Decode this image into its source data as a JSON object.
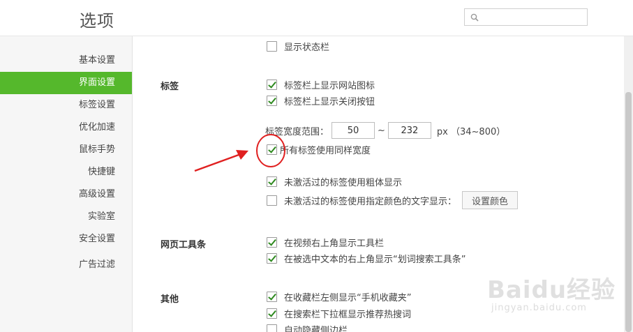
{
  "header": {
    "title": "选项",
    "search": {
      "placeholder": "",
      "value": ""
    }
  },
  "sidebar": {
    "items": [
      {
        "label": "基本设置",
        "active": false
      },
      {
        "label": "界面设置",
        "active": true
      },
      {
        "label": "标签设置",
        "active": false
      },
      {
        "label": "优化加速",
        "active": false
      },
      {
        "label": "鼠标手势",
        "active": false
      },
      {
        "label": "快捷键",
        "active": false
      },
      {
        "label": "高级设置",
        "active": false
      },
      {
        "label": "实验室",
        "active": false
      },
      {
        "label": "安全设置",
        "active": false
      },
      {
        "label": "广告过滤",
        "active": false
      }
    ]
  },
  "content": {
    "top_option": {
      "label": "显示状态栏",
      "checked": false
    },
    "tabs_section": {
      "title": "标签",
      "options": [
        {
          "label": "标签栏上显示网站图标",
          "checked": true
        },
        {
          "label": "标签栏上显示关闭按钮",
          "checked": true
        }
      ],
      "width_range": {
        "label": "标签宽度范围：",
        "min_value": "50",
        "separator": "~",
        "max_value": "232",
        "unit_hint": "px （34~800）"
      },
      "same_width": {
        "label": "所有标签使用同样宽度",
        "checked": true
      },
      "bold_inactive": {
        "label": "未激活过的标签使用粗体显示",
        "checked": true
      },
      "color_inactive": {
        "label": "未激活过的标签使用指定颜色的文字显示：",
        "checked": false
      },
      "set_color_button": "设置颜色"
    },
    "toolbar_section": {
      "title": "网页工具条",
      "options": [
        {
          "label": "在视频右上角显示工具栏",
          "checked": true
        },
        {
          "label": "在被选中文本的右上角显示“划词搜索工具条”",
          "checked": true
        }
      ]
    },
    "other_section": {
      "title": "其他",
      "options": [
        {
          "label": "在收藏栏左侧显示“手机收藏夹”",
          "checked": true
        },
        {
          "label": "在搜索栏下拉框显示推荐热搜词",
          "checked": true
        },
        {
          "label": "自动隐藏侧边栏",
          "checked": false
        }
      ]
    }
  },
  "annotation": {
    "color": "#e02020"
  },
  "watermark": {
    "brand": "Baidu经验",
    "url": "jingyan.baidu.com"
  },
  "colors": {
    "accent": "#55b82c",
    "check": "#2f8a20"
  }
}
